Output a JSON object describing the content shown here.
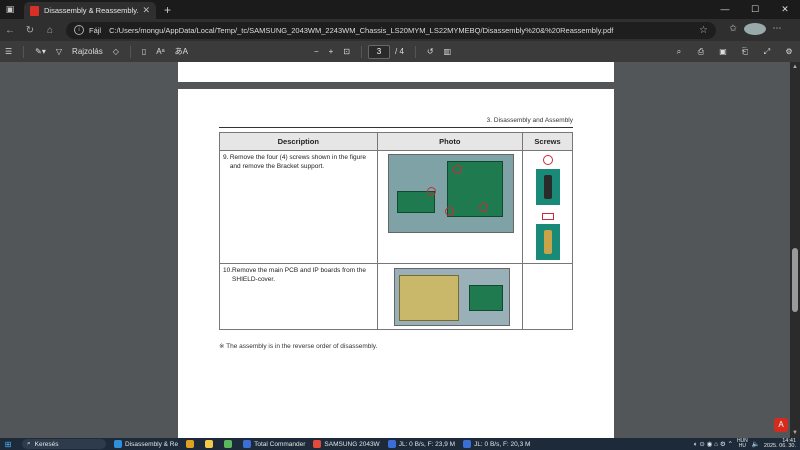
{
  "browser": {
    "tab_title": "Disassembly & Reassembly.pdf",
    "url_protocol": "Fájl",
    "url_path": "C:/Users/mongu/AppData/Local/Temp/_tc/SAMSUNG_2043WM_2243WM_Chassis_LS20MYM_LS22MYMEBQ/Disassembly%20&%20Reassembly.pdf"
  },
  "pdf_toolbar": {
    "draw_label": "Rajzolás",
    "read_aloud": "Aᵃ",
    "translate": "あA",
    "current_page": "3",
    "total_pages": "/ 4"
  },
  "document": {
    "header": "3. Disassembly and Assembly",
    "columns": [
      "Description",
      "Photo",
      "Screws"
    ],
    "steps": [
      {
        "number": "9.",
        "text": "Remove the four (4) screws shown in the figure and remove the Bracket support."
      },
      {
        "number": "10.",
        "text": "Remove the main PCB and IP boards from the SHIELD-cover."
      }
    ],
    "note": "※ The assembly is in the reverse order of disassembly."
  },
  "taskbar": {
    "search": "Keresés",
    "tasks": [
      {
        "label": "Disassembly & Re",
        "color": "#2f8fd8"
      },
      {
        "label": "",
        "color": "#e0a020"
      },
      {
        "label": "",
        "color": "#f2c94c"
      },
      {
        "label": "",
        "color": "#5cb85c"
      },
      {
        "label": "Total Commander",
        "color": "#3a6fd8"
      },
      {
        "label": "SAMSUNG 2043W",
        "color": "#e24a3b"
      },
      {
        "label": "JL: 0 B/s, F: 23,9 M",
        "color": "#3a6fd8"
      },
      {
        "label": "JL: 0 B/s, F: 20,3 M",
        "color": "#3a6fd8"
      }
    ],
    "lang_top": "HUN",
    "lang_bottom": "HU",
    "time": "14:41",
    "date": "2025. 06. 30."
  }
}
